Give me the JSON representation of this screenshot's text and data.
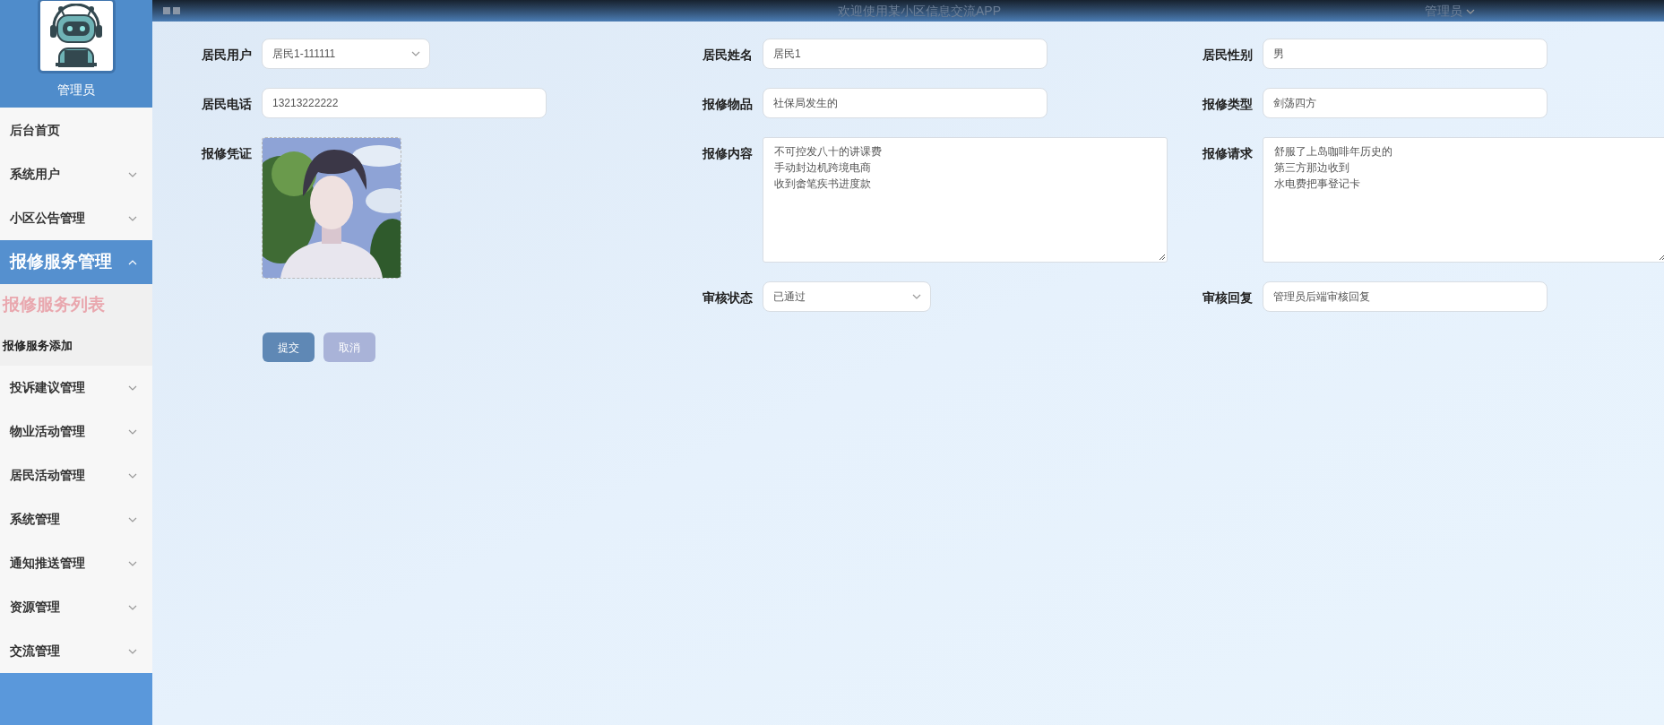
{
  "header": {
    "title": "欢迎使用某小区信息交流APP",
    "user": "管理员"
  },
  "sidebar": {
    "role": "管理员",
    "items": [
      {
        "label": "后台首页",
        "kind": "link"
      },
      {
        "label": "系统用户",
        "kind": "menu",
        "expanded": false
      },
      {
        "label": "小区公告管理",
        "kind": "menu",
        "expanded": false
      },
      {
        "label": "报修服务管理",
        "kind": "menu",
        "expanded": true,
        "children": [
          {
            "label": "报修服务列表",
            "selected": true
          },
          {
            "label": "报修服务添加",
            "selected": false
          }
        ]
      },
      {
        "label": "投诉建议管理",
        "kind": "menu",
        "expanded": false
      },
      {
        "label": "物业活动管理",
        "kind": "menu",
        "expanded": false
      },
      {
        "label": "居民活动管理",
        "kind": "menu",
        "expanded": false
      },
      {
        "label": "系统管理",
        "kind": "menu",
        "expanded": false
      },
      {
        "label": "通知推送管理",
        "kind": "menu",
        "expanded": false
      },
      {
        "label": "资源管理",
        "kind": "menu",
        "expanded": false
      },
      {
        "label": "交流管理",
        "kind": "menu",
        "expanded": false
      }
    ]
  },
  "form": {
    "columns": [
      [
        {
          "label": "居民用户",
          "kind": "select",
          "value": "居民1-111111"
        },
        {
          "label": "居民电话",
          "kind": "text",
          "value": "13213222222"
        },
        {
          "label": "报修凭证"
        }
      ],
      [
        {
          "label": "居民姓名",
          "kind": "text",
          "value": "居民1"
        },
        {
          "label": "报修物品",
          "kind": "text",
          "value": "社保局发生的"
        },
        {
          "label": "报修内容",
          "kind": "textarea",
          "lines": [
            "不可控发八十的讲课费",
            "手动封边机跨境电商",
            "收到畲笔疾书进度款"
          ]
        },
        {
          "label": "审核状态",
          "kind": "select",
          "value": "已通过"
        }
      ],
      [
        {
          "label": "居民性别",
          "kind": "text",
          "value": "男"
        },
        {
          "label": "报修类型",
          "kind": "text",
          "value": "剑荡四方"
        },
        {
          "label": "报修请求",
          "kind": "textarea",
          "lines": [
            "舒服了上岛咖啡年历史的",
            "第三方那边收到",
            "水电费把事登记卡"
          ]
        },
        {
          "label": "审核回复",
          "kind": "text",
          "value": "管理员后端审核回复"
        }
      ]
    ],
    "buttons": [
      {
        "label": "提交",
        "kind": "primary"
      },
      {
        "label": "取消",
        "kind": "secondary"
      }
    ]
  }
}
